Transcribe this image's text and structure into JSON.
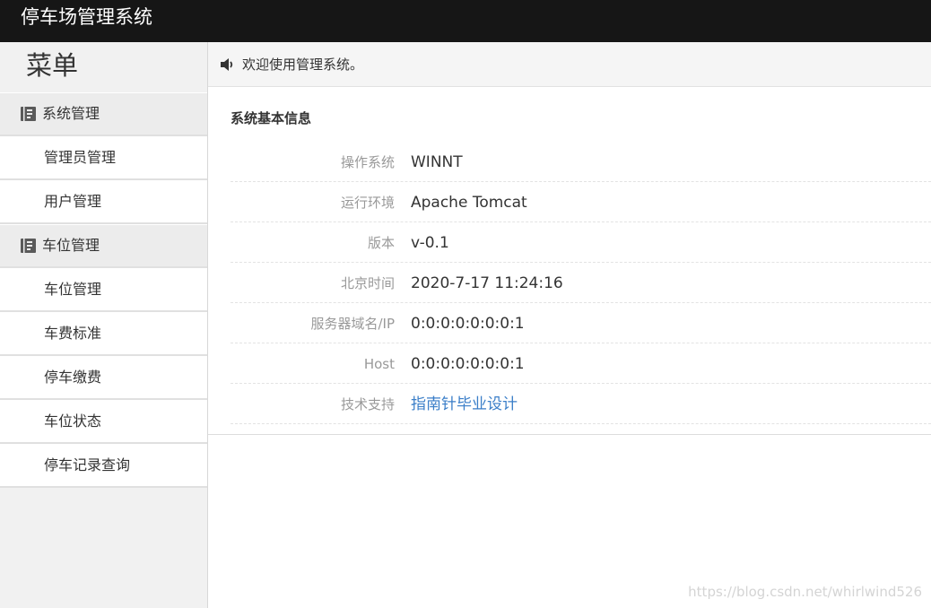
{
  "app": {
    "title": "停车场管理系统"
  },
  "sidebar": {
    "title": "菜单",
    "icon": "book-icon",
    "items": [
      {
        "type": "group",
        "label": "系统管理"
      },
      {
        "type": "item",
        "label": "管理员管理"
      },
      {
        "type": "item",
        "label": "用户管理"
      },
      {
        "type": "group",
        "label": "车位管理"
      },
      {
        "type": "item",
        "label": "车位管理"
      },
      {
        "type": "item",
        "label": "车费标准"
      },
      {
        "type": "item",
        "label": "停车缴费"
      },
      {
        "type": "item",
        "label": "车位状态"
      },
      {
        "type": "item",
        "label": "停车记录查询"
      }
    ]
  },
  "header": {
    "icon": "speaker-icon",
    "welcome": "欢迎使用管理系统。"
  },
  "info": {
    "title": "系统基本信息",
    "rows": [
      {
        "label": "操作系统",
        "value": "WINNT"
      },
      {
        "label": "运行环境",
        "value": "Apache Tomcat"
      },
      {
        "label": "版本",
        "value": "v-0.1"
      },
      {
        "label": "北京时间",
        "value": "2020-7-17 11:24:16"
      },
      {
        "label": "服务器域名/IP",
        "value": "0:0:0:0:0:0:0:1"
      },
      {
        "label": "Host",
        "value": "0:0:0:0:0:0:0:1"
      },
      {
        "label": "技术支持",
        "value": "指南针毕业设计"
      }
    ]
  },
  "watermark": "https://blog.csdn.net/whirlwind526",
  "colors": {
    "topbar": "#161616",
    "sidebar": "#f1f1f1",
    "link": "#3a7ec8",
    "label": "#999999"
  }
}
